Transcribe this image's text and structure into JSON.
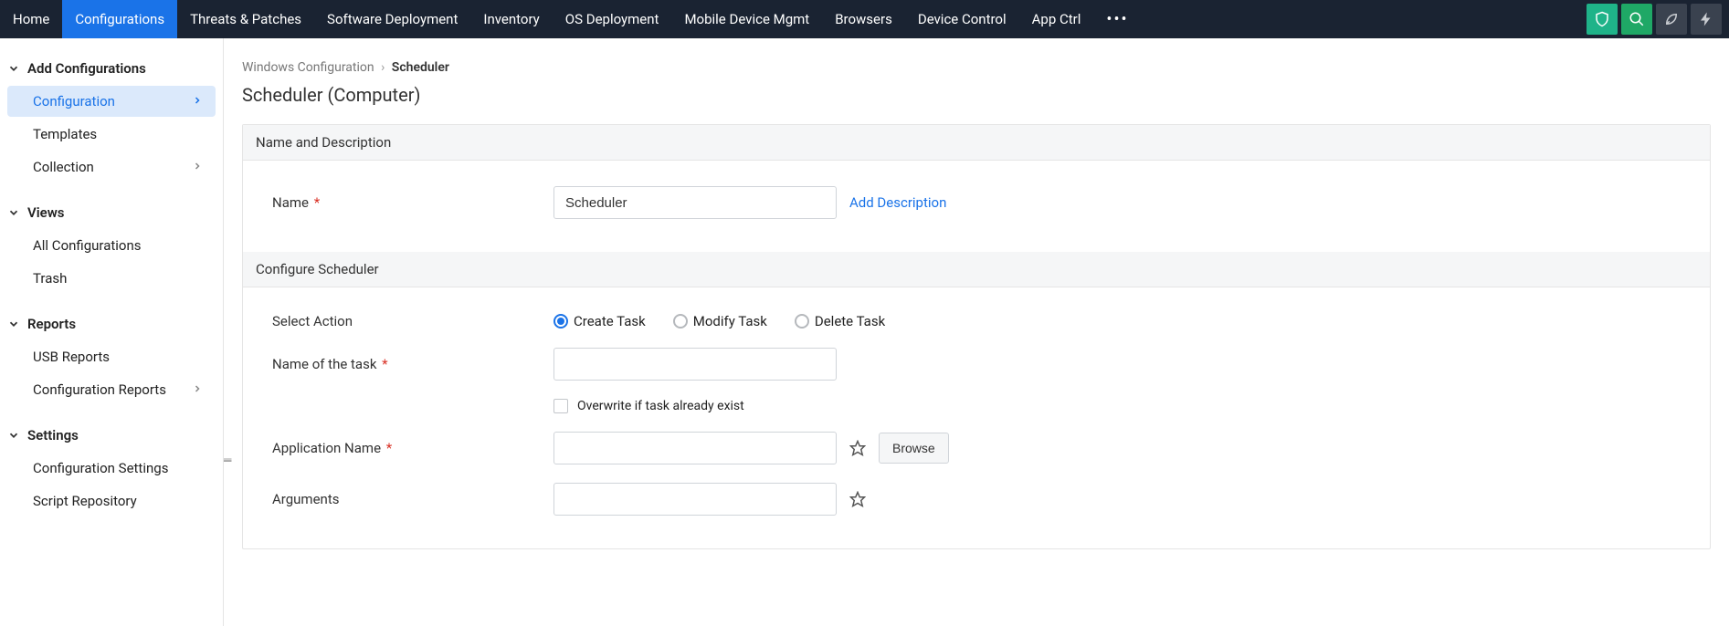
{
  "topnav": {
    "items": [
      {
        "label": "Home",
        "active": false
      },
      {
        "label": "Configurations",
        "active": true
      },
      {
        "label": "Threats & Patches",
        "active": false
      },
      {
        "label": "Software Deployment",
        "active": false
      },
      {
        "label": "Inventory",
        "active": false
      },
      {
        "label": "OS Deployment",
        "active": false
      },
      {
        "label": "Mobile Device Mgmt",
        "active": false
      },
      {
        "label": "Browsers",
        "active": false
      },
      {
        "label": "Device Control",
        "active": false
      },
      {
        "label": "App Ctrl",
        "active": false
      }
    ],
    "ellipsis": "•••"
  },
  "sidebar": {
    "groups": [
      {
        "title": "Add Configurations",
        "items": [
          {
            "label": "Configuration",
            "active": true,
            "hasSub": true
          },
          {
            "label": "Templates",
            "active": false,
            "hasSub": false
          },
          {
            "label": "Collection",
            "active": false,
            "hasSub": true
          }
        ]
      },
      {
        "title": "Views",
        "items": [
          {
            "label": "All Configurations",
            "active": false,
            "hasSub": false
          },
          {
            "label": "Trash",
            "active": false,
            "hasSub": false
          }
        ]
      },
      {
        "title": "Reports",
        "items": [
          {
            "label": "USB Reports",
            "active": false,
            "hasSub": false
          },
          {
            "label": "Configuration Reports",
            "active": false,
            "hasSub": true
          }
        ]
      },
      {
        "title": "Settings",
        "items": [
          {
            "label": "Configuration Settings",
            "active": false,
            "hasSub": false
          },
          {
            "label": "Script Repository",
            "active": false,
            "hasSub": false
          }
        ]
      }
    ]
  },
  "breadcrumb": {
    "root": "Windows Configuration",
    "current": "Scheduler"
  },
  "page": {
    "title": "Scheduler (Computer)",
    "section_name_desc": "Name and Description",
    "section_configure": "Configure Scheduler",
    "name_label": "Name",
    "name_value": "Scheduler",
    "add_description": "Add Description",
    "select_action_label": "Select Action",
    "actions": {
      "create": "Create Task",
      "modify": "Modify Task",
      "delete": "Delete Task",
      "selected": "create"
    },
    "task_name_label": "Name of the task",
    "overwrite_label": "Overwrite if task already exist",
    "app_name_label": "Application Name",
    "browse_label": "Browse",
    "arguments_label": "Arguments"
  }
}
